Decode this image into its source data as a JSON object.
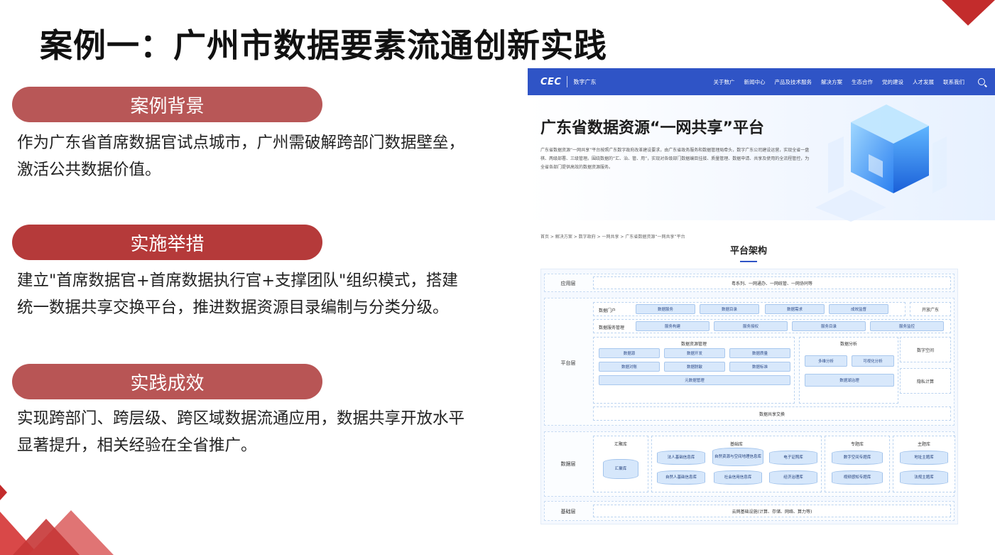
{
  "title": "案例一：广州市数据要素流通创新实践",
  "sections": [
    {
      "label": "案例背景",
      "text": "作为广东省首席数据官试点城市，广州需破解跨部门数据壁垒，激活公共数据价值。"
    },
    {
      "label": "实施举措",
      "text": "建立\"首席数据官+首席数据执行官+支撑团队\"组织模式，搭建统一数据共享交换平台，推进数据资源目录编制与分类分级。"
    },
    {
      "label": "实践成效",
      "text": "实现跨部门、跨层级、跨区域数据流通应用，数据共享开放水平显著提升，相关经验在全省推广。"
    }
  ],
  "colors": {
    "accent": "#c0393b",
    "nav": "#2f54c6"
  },
  "screenshot": {
    "brand": "CEC",
    "brand_sub": "数字广东",
    "nav_items": [
      "关于数广",
      "新闻中心",
      "产品及技术服务",
      "解决方案",
      "生态合作",
      "党的建设",
      "人才发展",
      "联系我们"
    ],
    "hero_title": "广东省数据资源“一网共享”平台",
    "hero_desc": "广东省数据资源“一网共享”平台按照广东数字政府改革建设要求，由广东省政务服务和数据管理局牵头，数字广东公司建设运营，实现全省一盘棋、两级部署、三级管理。围绕数据的“汇、治、管、用”，实现对各级部门数据编目挂接、质量管理、数据申请、共享及使用的全流程管控，为全省各部门提供高效的数据资源服务。",
    "breadcrumb": "首页 > 解决方案 > 数字政府 > 一网共享 > 广东省数据资源“一网共享”平台",
    "arch_title": "平台架构",
    "app_layer": {
      "name": "应用层",
      "content": "粤系列、一网通办、一网统管、一网协同等"
    },
    "platform_layer": {
      "name": "平台层",
      "portal_label": "数据门户",
      "portal_items": [
        "数据服务",
        "数据目录",
        "数据需求",
        "成效监督"
      ],
      "open_label": "开放广东",
      "svc_label": "数据服务管理",
      "svc_items": [
        "服务构建",
        "服务授权",
        "服务目录",
        "服务监控"
      ],
      "resmgmt_label": "数据资源管理",
      "resmgmt_items": [
        "数据源",
        "数据开发",
        "数据质量",
        "数据对账",
        "数据脱敏",
        "数据标准"
      ],
      "metadata": "元数据管理",
      "analysis_label": "数据分析",
      "analysis_items": [
        "多维分析",
        "可视化分析"
      ],
      "governance": "数据湖治理",
      "right_items": [
        "数字空间",
        "隐私计算"
      ],
      "exchange": "数据共享交换"
    },
    "data_layer": {
      "name": "数据层",
      "g1_label": "汇聚库",
      "g1_item": "汇聚库",
      "g2_label": "基础库",
      "g2_items": [
        "法人基础信息库",
        "自然资源与空间地理信息库",
        "电子证照库",
        "自然人基础信息库",
        "社会信用信息库",
        "经济治理库"
      ],
      "g3_label": "专题库",
      "g3_items": [
        "数字空间专题库",
        "视频感知专题库"
      ],
      "g4_label": "主题库",
      "g4_items": [
        "地址主题库",
        "法规主题库"
      ]
    },
    "infra_layer": {
      "name": "基础层",
      "content": "云网基础设施(计算、存储、网络、算力等)"
    }
  }
}
